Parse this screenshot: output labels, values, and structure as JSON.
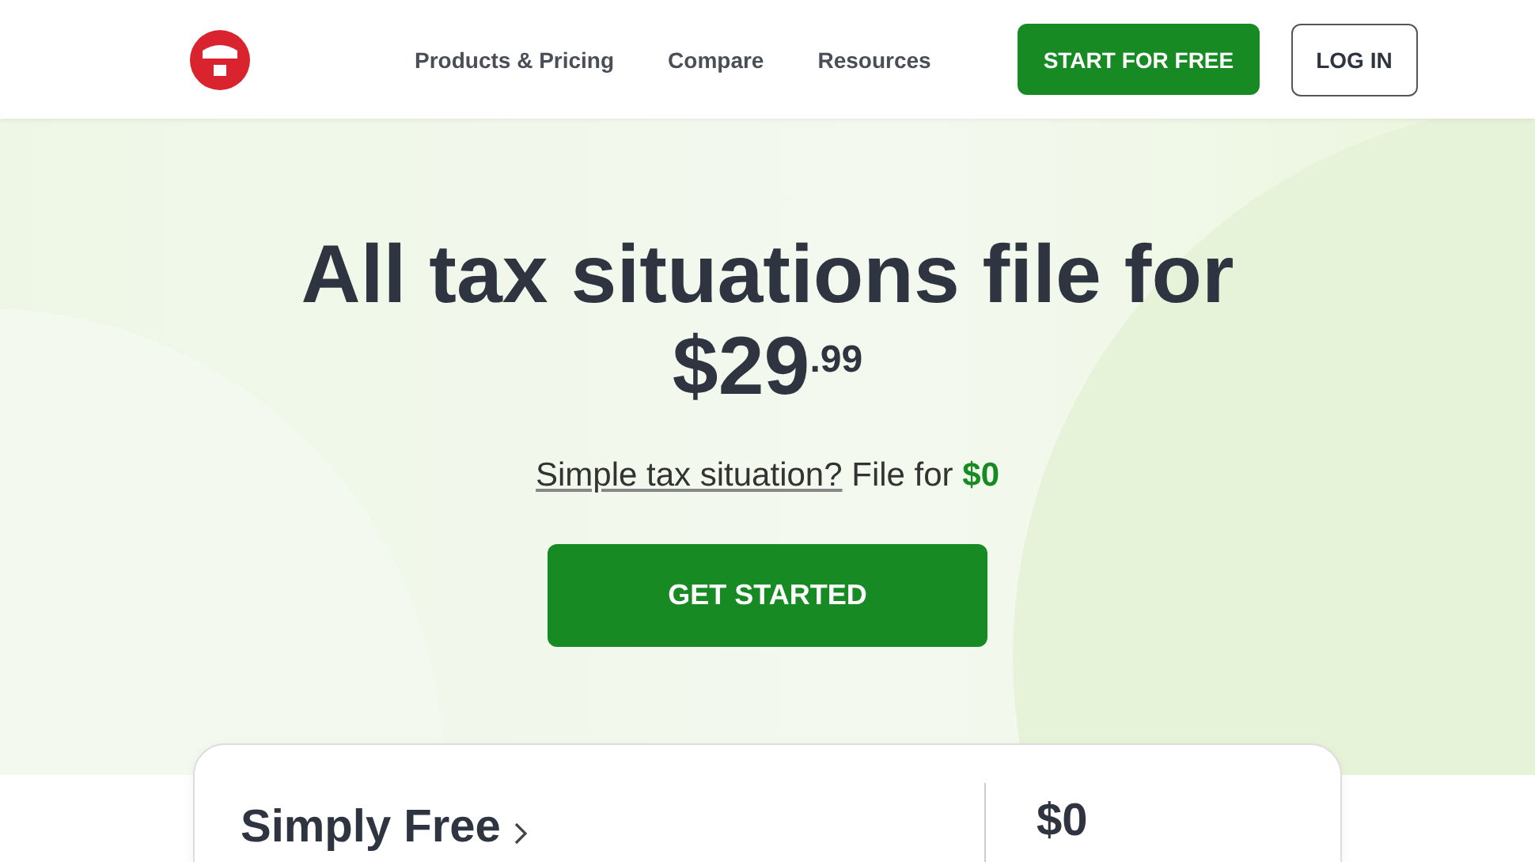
{
  "nav": {
    "links": [
      "Products & Pricing",
      "Compare",
      "Resources"
    ],
    "primary_button": "START FOR FREE",
    "secondary_button": "LOG IN"
  },
  "hero": {
    "headline": "All tax situations file for $29$^{.99}$",
    "subline_link": "Simple tax situation?",
    "subline_text": "File for **$0**",
    "cta": "GET STARTED"
  },
  "plan_card": {
    "title": "Simply Free",
    "price": "$0"
  }
}
